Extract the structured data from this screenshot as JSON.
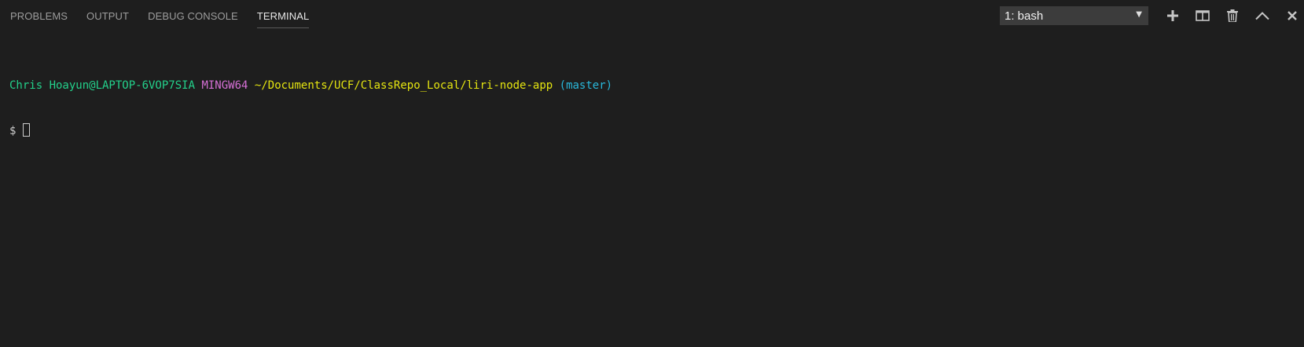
{
  "tabs": [
    {
      "label": "PROBLEMS"
    },
    {
      "label": "OUTPUT"
    },
    {
      "label": "DEBUG CONSOLE"
    },
    {
      "label": "TERMINAL",
      "active": true
    }
  ],
  "terminal_selector": {
    "selected": "1: bash",
    "arrow": "▼"
  },
  "actions": [
    {
      "name": "new-terminal",
      "icon": "plus-icon"
    },
    {
      "name": "split-terminal",
      "icon": "split-icon"
    },
    {
      "name": "kill-terminal",
      "icon": "trash-icon"
    },
    {
      "name": "maximize-panel",
      "icon": "chevron-up-icon"
    },
    {
      "name": "close-panel",
      "icon": "close-icon"
    }
  ],
  "terminal": {
    "user_host": "Chris Hoayun@LAPTOP-6VOP7SIA",
    "system": "MINGW64",
    "path": "~/Documents/UCF/ClassRepo_Local/liri-node-app",
    "branch": "(master)",
    "prompt": "$ "
  },
  "colors": {
    "background": "#1e1e1e",
    "user_host": "#23d18b",
    "system": "#d670d6",
    "path": "#e5e510",
    "branch": "#29b8db",
    "text": "#cccccc"
  }
}
